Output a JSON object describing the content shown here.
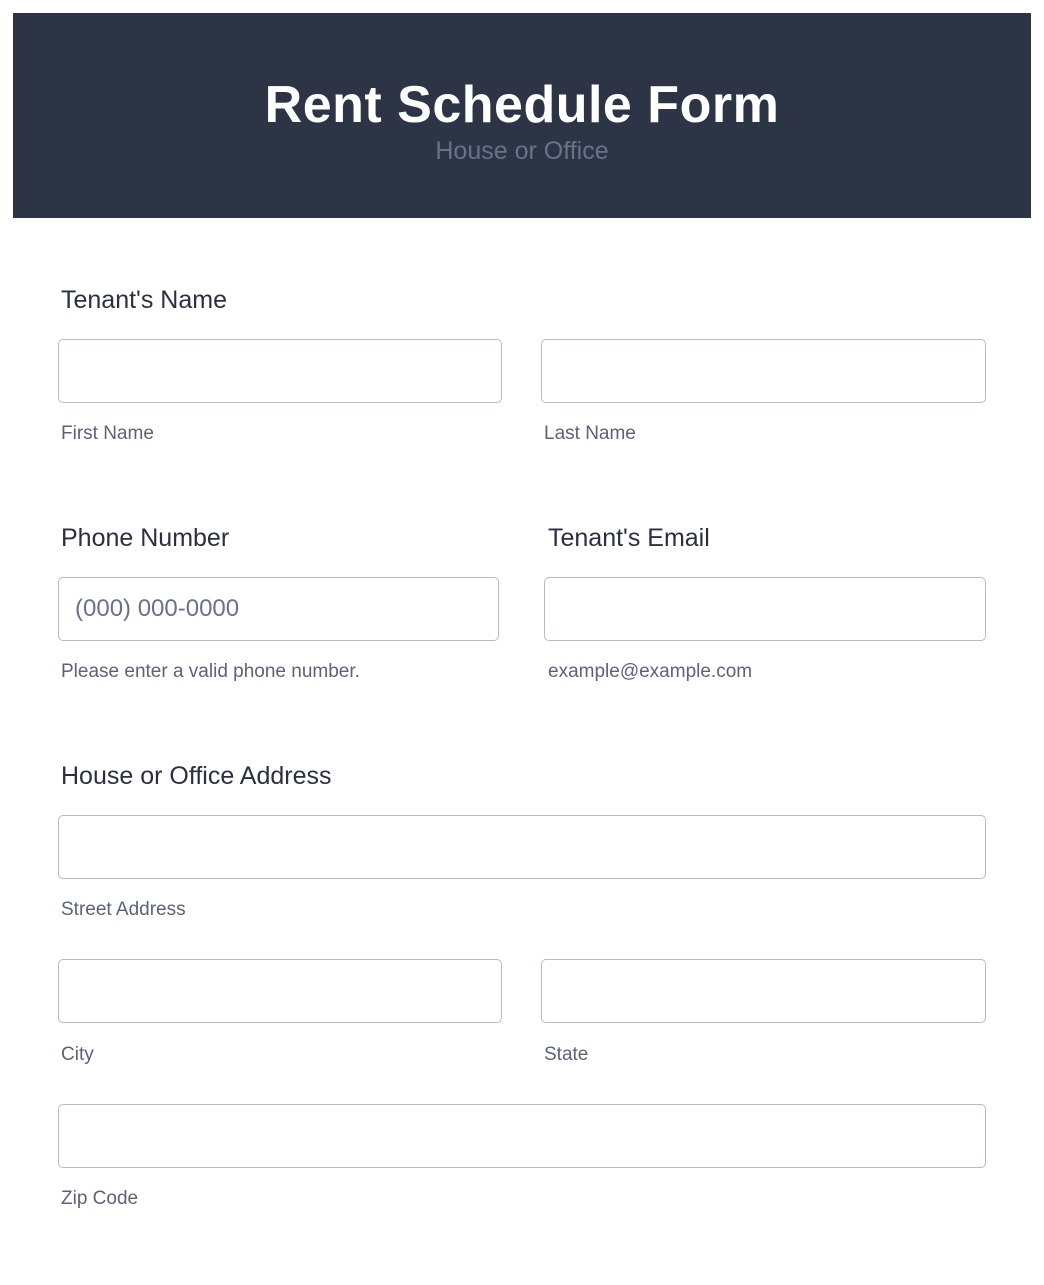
{
  "header": {
    "title": "Rent Schedule Form",
    "subtitle": "House or Office"
  },
  "tenant_name": {
    "label": "Tenant's Name",
    "first_name": {
      "value": "",
      "sublabel": "First Name"
    },
    "last_name": {
      "value": "",
      "sublabel": "Last Name"
    }
  },
  "phone": {
    "label": "Phone Number",
    "value": "",
    "placeholder": "(000) 000-0000",
    "sublabel": "Please enter a valid phone number."
  },
  "email": {
    "label": "Tenant's Email",
    "value": "",
    "sublabel": "example@example.com"
  },
  "address": {
    "label": "House or Office Address",
    "street": {
      "value": "",
      "sublabel": "Street Address"
    },
    "city": {
      "value": "",
      "sublabel": "City"
    },
    "state": {
      "value": "",
      "sublabel": "State"
    },
    "zip": {
      "value": "",
      "sublabel": "Zip Code"
    }
  },
  "colors": {
    "header_bg": "#2d3446",
    "title": "#ffffff",
    "subtitle": "#6a7287",
    "label": "#2a3042",
    "sublabel": "#5a6378",
    "field_border": "#b7bbc9"
  }
}
